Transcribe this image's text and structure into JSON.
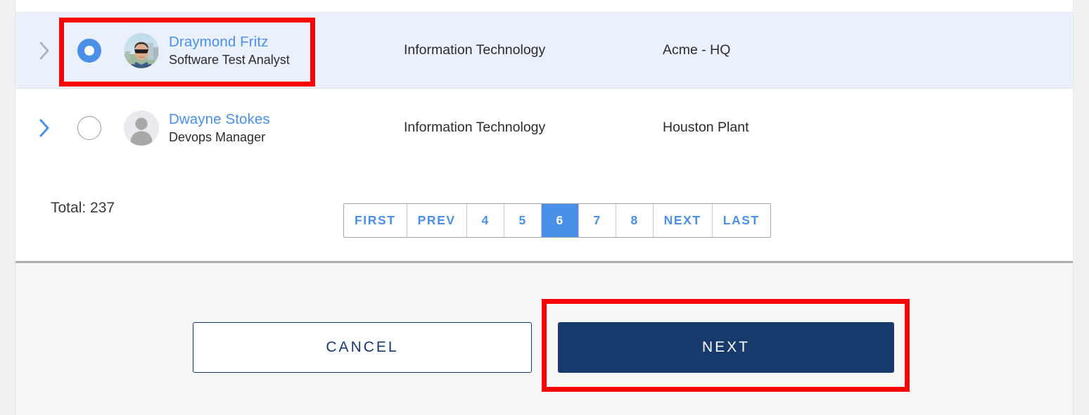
{
  "table": {
    "rows": [
      {
        "expand_icon": "chevron-right-icon",
        "selected": true,
        "avatar_type": "photo-avatar",
        "name": "Draymond Fritz",
        "title": "Software Test Analyst",
        "department": "Information Technology",
        "location": "Acme - HQ"
      },
      {
        "expand_icon": "chevron-right-icon",
        "selected": false,
        "avatar_type": "placeholder-avatar",
        "name": "Dwayne Stokes",
        "title": "Devops Manager",
        "department": "Information Technology",
        "location": "Houston Plant"
      }
    ]
  },
  "pagination": {
    "total_label": "Total: 237",
    "buttons": [
      {
        "label": "FIRST",
        "kind": "nav",
        "active": false
      },
      {
        "label": "PREV",
        "kind": "nav",
        "active": false
      },
      {
        "label": "4",
        "kind": "num",
        "active": false
      },
      {
        "label": "5",
        "kind": "num",
        "active": false
      },
      {
        "label": "6",
        "kind": "num",
        "active": true
      },
      {
        "label": "7",
        "kind": "num",
        "active": false
      },
      {
        "label": "8",
        "kind": "num",
        "active": false
      },
      {
        "label": "NEXT",
        "kind": "nav",
        "active": false
      },
      {
        "label": "LAST",
        "kind": "nav",
        "active": false
      }
    ],
    "current_page": "6"
  },
  "footer": {
    "cancel_label": "CANCEL",
    "next_label": "NEXT"
  },
  "colors": {
    "accent_blue": "#4a90e8",
    "row_highlight": "#eaf1fd",
    "primary_navy": "#173a6d",
    "annotation_red": "#fb0007",
    "footer_bg": "#f6f6f7"
  },
  "annotations": [
    {
      "target": "row-selection-control",
      "color": "#fb0007"
    },
    {
      "target": "next-button",
      "color": "#fb0007"
    }
  ]
}
